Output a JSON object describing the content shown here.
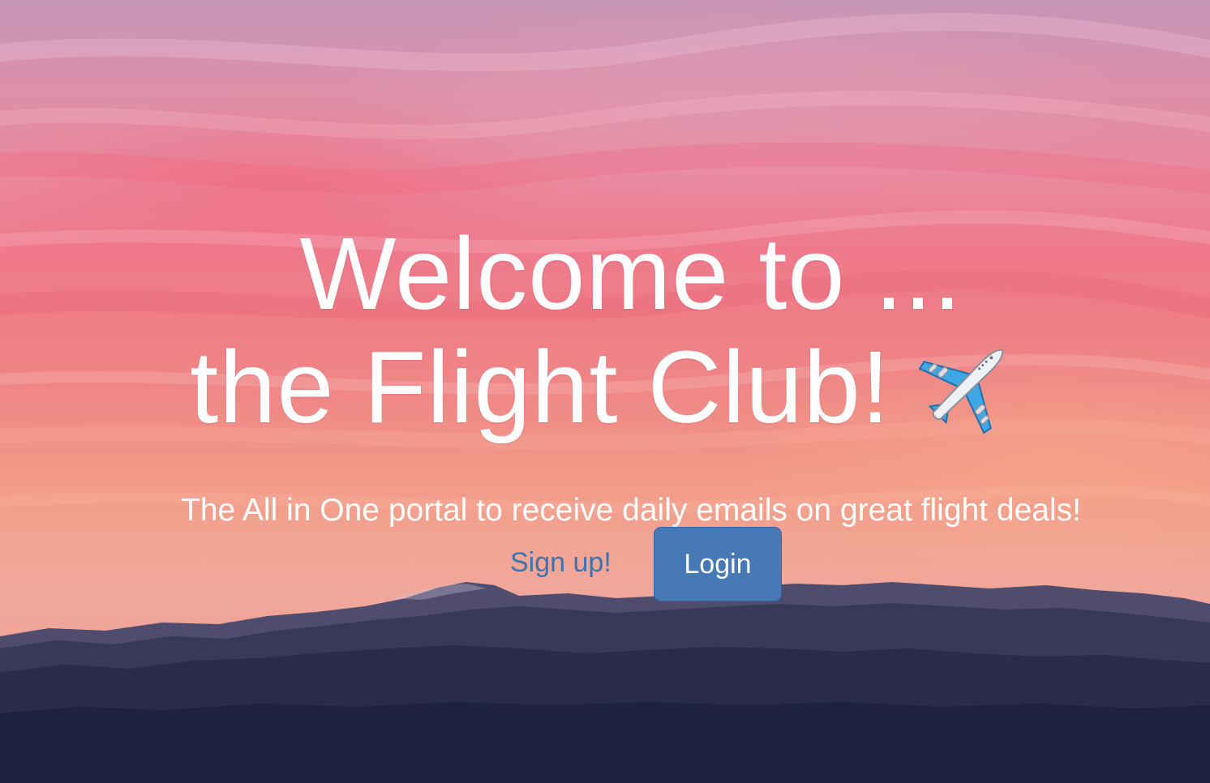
{
  "hero": {
    "title_line1": "Welcome to ...",
    "title_line2": "the Flight Club!",
    "title_emoji_icon": "airplane-icon",
    "tagline": "The All in One portal to receive daily emails on great flight deals!"
  },
  "actions": {
    "signup_label": "Sign up!",
    "login_label": "Login"
  },
  "colors": {
    "link": "#3b73b3",
    "button": "#4679b6",
    "heading": "#ffffff",
    "mountains": "#1e2140"
  }
}
